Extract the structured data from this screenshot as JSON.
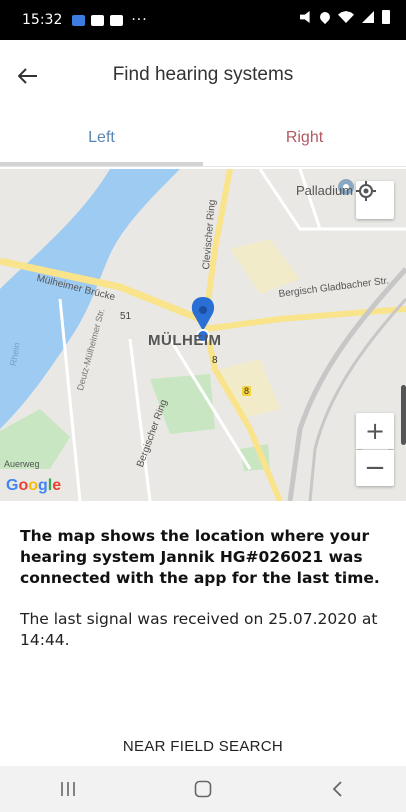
{
  "status_bar": {
    "time": "15:32",
    "dots": "···"
  },
  "header": {
    "title": "Find hearing systems",
    "back_icon": "arrow-back-icon"
  },
  "tabs": [
    {
      "label": "Left",
      "selected": true,
      "color": "#5b86b4"
    },
    {
      "label": "Right",
      "selected": false,
      "color": "#b35a62"
    }
  ],
  "map": {
    "labels": {
      "palladium": "Palladium",
      "clevischer_ring": "Clevischer Ring",
      "muelheimer_bruecke": "Mülheimer Brücke",
      "route_51": "51",
      "bergisch_gladbacher": "Bergisch Gladbacher Str.",
      "district": "MÜLHEIM",
      "route_8a": "8",
      "route_8b": "8",
      "deutz_muelheimer": "Deutz-Mülheimer Str.",
      "rhein": "Rhein",
      "bergischer_ring": "Bergischer Ring",
      "auerweg": "Auerweg"
    },
    "google_logo": [
      "G",
      "o",
      "o",
      "g",
      "l",
      "e"
    ],
    "zoom_in": "+",
    "zoom_out": "−",
    "colors": {
      "water": "#9ecbf2",
      "park": "#c8e6c1",
      "road_major": "#f9e48b",
      "marker": "#2a6fd6"
    }
  },
  "message": {
    "location_text": "The map shows the location where your hearing system Jannik HG#026021 was connected with the app for the last time.",
    "signal_text": "The last signal was received on 25.07.2020 at 14:44."
  },
  "actions": {
    "near_field_search": "NEAR FIELD SEARCH"
  },
  "nav_bar": {
    "recent_icon": "recent-apps-icon",
    "home_icon": "home-icon",
    "back_icon": "back-icon"
  }
}
